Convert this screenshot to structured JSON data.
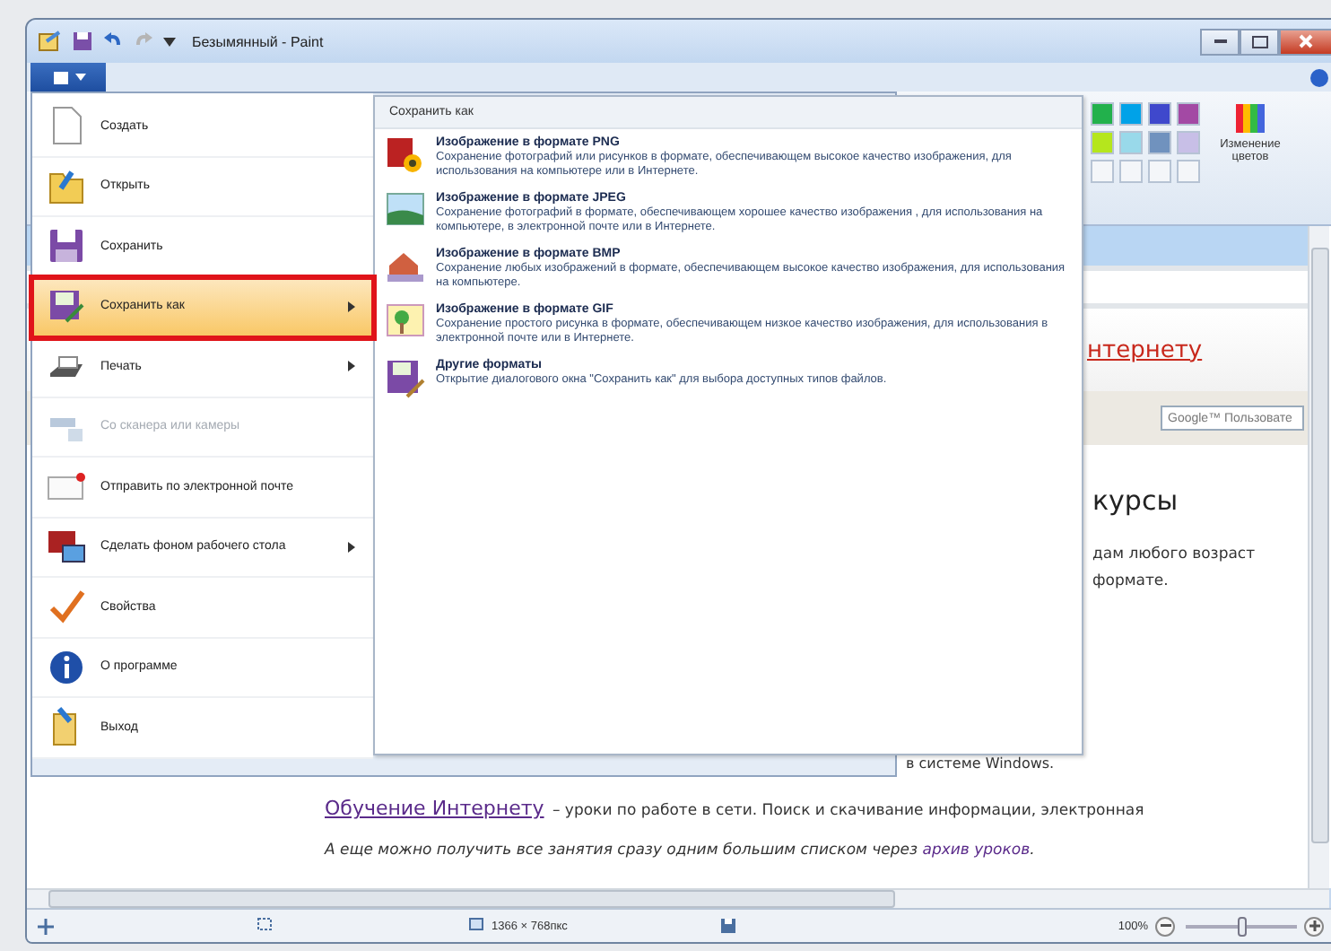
{
  "window": {
    "title": "Безымянный - Paint"
  },
  "ribbon": {
    "palette": [
      {
        "color": "#22b14c"
      },
      {
        "color": "#00a2e8"
      },
      {
        "color": "#3f48cc"
      },
      {
        "color": "#a349a4"
      },
      {
        "color": "#b5e61d"
      },
      {
        "color": "#99d9ea"
      },
      {
        "color": "#7092be"
      },
      {
        "color": "#c8bfe7"
      },
      {
        "color": "#f4f6f9"
      },
      {
        "color": "#f4f6f9"
      },
      {
        "color": "#f4f6f9"
      },
      {
        "color": "#f4f6f9"
      }
    ],
    "edit_colors_label": "Изменение цветов"
  },
  "file_menu": {
    "items": [
      {
        "label": "Создать",
        "selected": false,
        "disabled": false,
        "has_submenu": false
      },
      {
        "label": "Открыть",
        "selected": false,
        "disabled": false,
        "has_submenu": false
      },
      {
        "label": "Сохранить",
        "selected": false,
        "disabled": false,
        "has_submenu": false
      },
      {
        "label": "Сохранить как",
        "selected": true,
        "disabled": false,
        "has_submenu": true
      },
      {
        "label": "Печать",
        "selected": false,
        "disabled": false,
        "has_submenu": true
      },
      {
        "label": "Со сканера или камеры",
        "selected": false,
        "disabled": true,
        "has_submenu": false
      },
      {
        "label": "Отправить по электронной почте",
        "selected": false,
        "disabled": false,
        "has_submenu": false
      },
      {
        "label": "Сделать фоном рабочего стола",
        "selected": false,
        "disabled": false,
        "has_submenu": true
      },
      {
        "label": "Свойства",
        "selected": false,
        "disabled": false,
        "has_submenu": false
      },
      {
        "label": "О программе",
        "selected": false,
        "disabled": false,
        "has_submenu": false
      },
      {
        "label": "Выход",
        "selected": false,
        "disabled": false,
        "has_submenu": false
      }
    ]
  },
  "save_as_panel": {
    "title": "Сохранить как",
    "options": [
      {
        "title": "Изображение в формате PNG",
        "description": "Сохранение фотографий или рисунков в формате, обеспечивающем высокое качество изображения, для использования на компьютере или в Интернете."
      },
      {
        "title": "Изображение в формате JPEG",
        "description": "Сохранение фотографий в формате, обеспечивающем хорошее качество изображения , для использования на компьютере, в электронной почте или в Интернете."
      },
      {
        "title": "Изображение в формате BMP",
        "description": "Сохранение любых изображений в формате, обеспечивающем высокое качество изображения, для использования на компьютере."
      },
      {
        "title": "Изображение в формате GIF",
        "description": "Сохранение простого рисунка в формате, обеспечивающем низкое качество изображения, для использования в электронной почте или в Интернете."
      },
      {
        "title": "Другие форматы",
        "description": "Открытие диалогового окна \"Сохранить как\" для выбора доступных типов файлов."
      }
    ]
  },
  "canvas_page": {
    "header_link": "нтернету",
    "search_placeholder": "Google™ Пользовате",
    "heading": "курсы",
    "intro_lines": [
      "дам любого возраст",
      "формате."
    ],
    "windows_line": "в системе Windows.",
    "internet_link": "Обучение Интернету",
    "internet_text": " – уроки по работе в сети. Поиск и скачивание информации, электронная",
    "archive_text": "А еще можно получить все занятия сразу одним большим списком через ",
    "archive_link": "архив уроков",
    "archive_end": "."
  },
  "status_bar": {
    "dimensions": "1366 × 768пкс",
    "zoom": "100%",
    "zoom_slider": {
      "level": 0.5
    }
  }
}
